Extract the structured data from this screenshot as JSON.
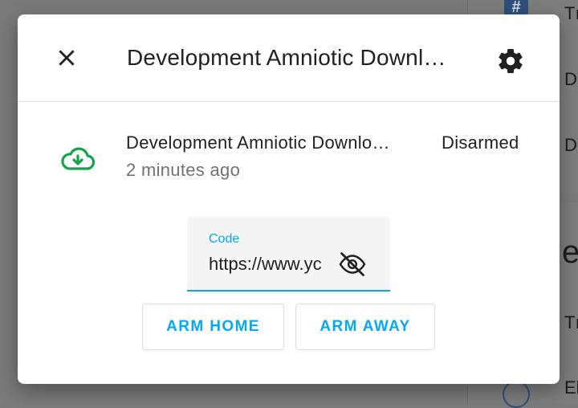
{
  "background": {
    "hash_glyph": "#",
    "side_texts": [
      "Tı",
      "D",
      "D",
      "Tı",
      "El"
    ],
    "big_char": "e"
  },
  "dialog": {
    "title": "Development Amniotic Downl…",
    "close_icon": "close-icon",
    "settings_icon": "gear-icon"
  },
  "entity": {
    "icon": "cloud-download-icon",
    "icon_color": "#16a34a",
    "name": "Development Amniotic Downlo…",
    "last_changed": "2 minutes ago",
    "state": "Disarmed"
  },
  "code_field": {
    "label": "Code",
    "value": "https://www.yc",
    "toggle_icon": "eye-off-icon"
  },
  "actions": {
    "arm_home": "ARM HOME",
    "arm_away": "ARM AWAY"
  },
  "colors": {
    "accent": "#03a9f4",
    "overlay": "#7a7a7a"
  }
}
